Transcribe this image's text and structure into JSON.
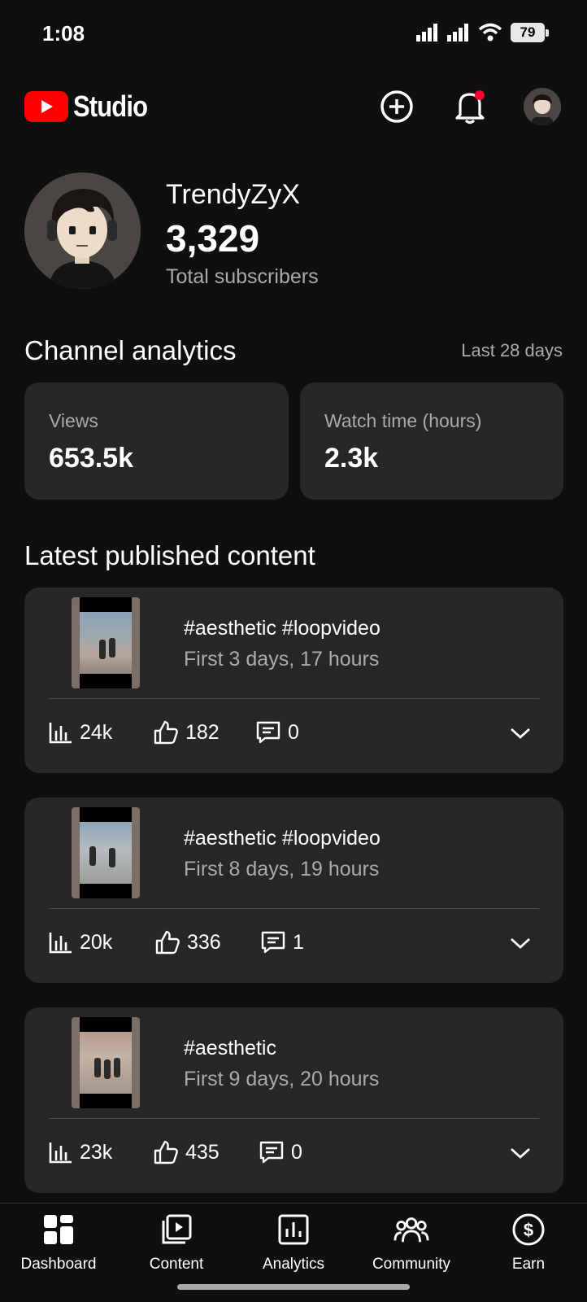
{
  "status_bar": {
    "time": "1:08",
    "battery": "79"
  },
  "header": {
    "app_name": "Studio"
  },
  "channel": {
    "name": "TrendyZyX",
    "subscribers": "3,329",
    "subscribers_label": "Total subscribers"
  },
  "analytics": {
    "title": "Channel analytics",
    "range": "Last 28 days",
    "cards": [
      {
        "label": "Views",
        "value": "653.5k"
      },
      {
        "label": "Watch time (hours)",
        "value": "2.3k"
      }
    ]
  },
  "latest": {
    "title": "Latest published content",
    "items": [
      {
        "title": "#aesthetic #loopvideo",
        "subtitle": "First 3 days, 17 hours",
        "views": "24k",
        "likes": "182",
        "comments": "0"
      },
      {
        "title": "#aesthetic #loopvideo",
        "subtitle": "First 8 days, 19 hours",
        "views": "20k",
        "likes": "336",
        "comments": "1"
      },
      {
        "title": "#aesthetic",
        "subtitle": "First 9 days, 20 hours",
        "views": "23k",
        "likes": "435",
        "comments": "0"
      }
    ]
  },
  "bottom_nav": [
    {
      "label": "Dashboard",
      "icon": "dashboard-icon"
    },
    {
      "label": "Content",
      "icon": "content-icon"
    },
    {
      "label": "Analytics",
      "icon": "analytics-icon"
    },
    {
      "label": "Community",
      "icon": "community-icon"
    },
    {
      "label": "Earn",
      "icon": "earn-icon"
    }
  ],
  "colors": {
    "accent": "#ff0000",
    "background": "#0f0f0f",
    "card": "#272727"
  }
}
